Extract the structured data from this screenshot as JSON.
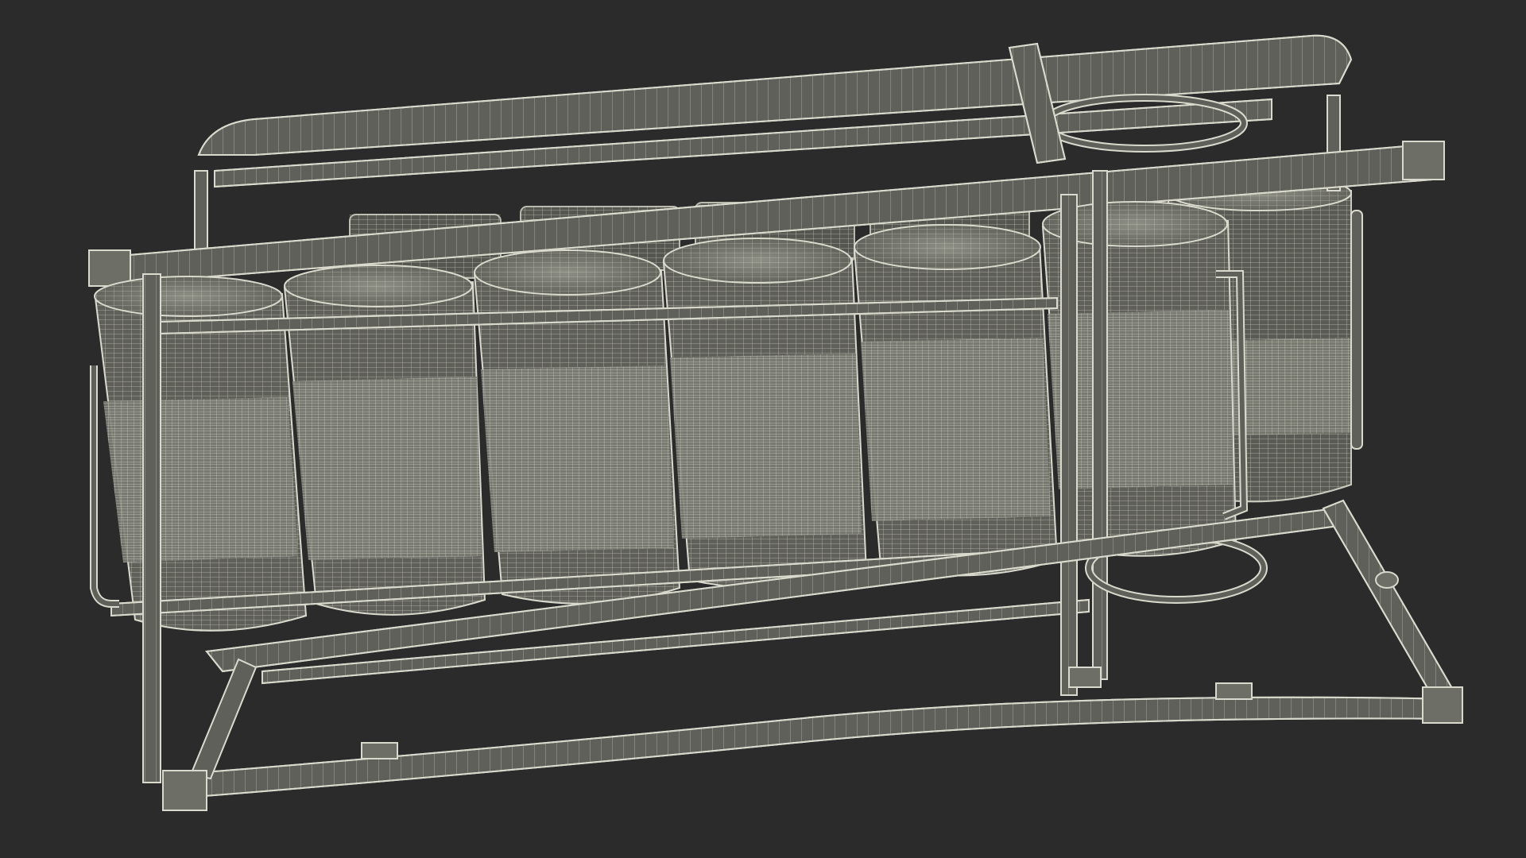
{
  "scene": {
    "subject": "wireframe-render",
    "render_mode": "wireframe",
    "canister_count": 12,
    "colors": {
      "background": "#2b2b2b",
      "mesh_fill": "#5f6059",
      "mesh_fill_dark": "#4f504a",
      "band_fill": "#7a7b72",
      "wire": "#d9dacd",
      "wire_soft": "#b9baad"
    }
  }
}
